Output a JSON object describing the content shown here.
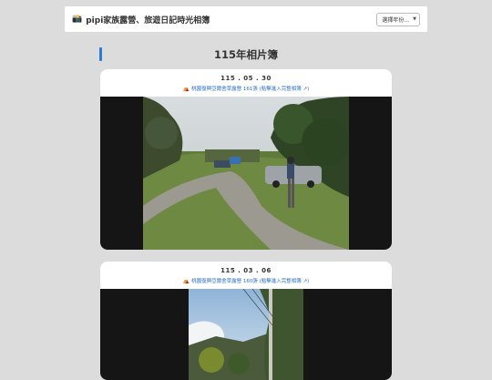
{
  "header": {
    "logo_icon": "camera-icon",
    "title": "pipi家族露營、旅遊日記時光相簿",
    "year_select": {
      "selected": "選擇年份...",
      "icon": "chevron-down-icon"
    }
  },
  "section": {
    "title": "115年相片簿",
    "accent_color": "#2b7bd6"
  },
  "albums": [
    {
      "date": "115 . 05 . 30",
      "link_icon": "tent-icon",
      "link_text": "桃園復興亞爾舍草露營 161張 (點擊進入完整相簿 ↗)",
      "photo_desc": "campsite-photo"
    },
    {
      "date": "115 . 03 . 06",
      "link_icon": "tent-icon",
      "link_text": "桃園復興亞爾舍草露營 160張 (點擊進入完整相簿 ↗)",
      "photo_desc": "mountain-photo"
    }
  ],
  "colors": {
    "page_bg": "#dcdcdc",
    "card_bg": "#ffffff",
    "link": "#2b6fc9",
    "photo_frame": "#151515"
  }
}
